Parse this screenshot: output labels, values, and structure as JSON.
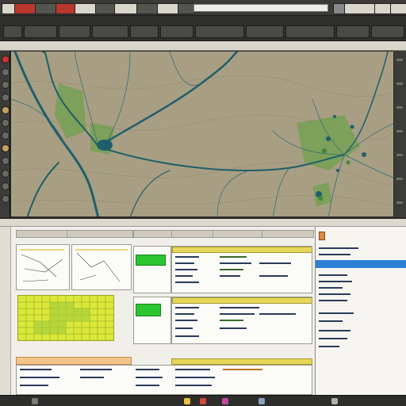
{
  "toolbar": {
    "buttons": [
      {
        "name": "file-button",
        "label": "",
        "variant": "light"
      },
      {
        "name": "save-button",
        "label": "",
        "variant": "red"
      },
      {
        "name": "edit-button",
        "label": "",
        "variant": ""
      },
      {
        "name": "view-button",
        "label": "",
        "variant": ""
      },
      {
        "name": "layer-button",
        "label": "",
        "variant": ""
      },
      {
        "name": "select-button",
        "label": "",
        "variant": ""
      },
      {
        "name": "tools-button",
        "label": "",
        "variant": ""
      },
      {
        "name": "analysis-button",
        "label": "",
        "variant": ""
      },
      {
        "name": "help-button",
        "label": "",
        "variant": "light"
      }
    ],
    "address_value": ""
  },
  "map": {
    "background": "#a89e83",
    "river_color": "#1f5f6a",
    "vegetation_color": "#5aa33a"
  },
  "bottom": {
    "columns": [
      "",
      "",
      "",
      "",
      "",
      ""
    ],
    "property_header": "",
    "property_selected": ""
  },
  "colors": {
    "accent_blue": "#2f7fd6",
    "highlight_yellow": "#e6d65a",
    "green_block": "#2bc531",
    "orange_band": "#f2c48a"
  }
}
